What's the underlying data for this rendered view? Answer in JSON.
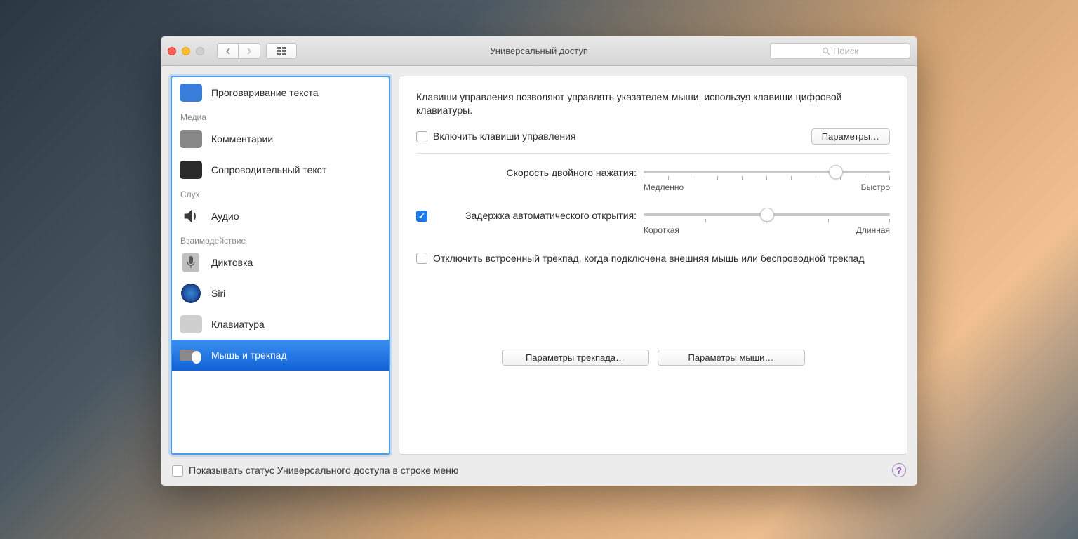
{
  "window": {
    "title": "Универсальный доступ"
  },
  "search": {
    "placeholder": "Поиск"
  },
  "sidebar": {
    "items": [
      {
        "label": "Проговаривание текста"
      },
      {
        "group": "Медиа"
      },
      {
        "label": "Комментарии"
      },
      {
        "label": "Сопроводительный текст"
      },
      {
        "group": "Слух"
      },
      {
        "label": "Аудио"
      },
      {
        "group": "Взаимодействие"
      },
      {
        "label": "Диктовка"
      },
      {
        "label": "Siri"
      },
      {
        "label": "Клавиатура"
      },
      {
        "label": "Мышь и трекпад"
      }
    ]
  },
  "main": {
    "description": "Клавиши управления позволяют управлять указателем мыши, используя клавиши цифровой клавиатуры.",
    "enable_keys": "Включить клавиши управления",
    "options_btn": "Параметры…",
    "double_click_label": "Скорость двойного нажатия:",
    "double_click_min": "Медленно",
    "double_click_max": "Быстро",
    "spring_delay_label": "Задержка автоматического открытия:",
    "spring_delay_min": "Короткая",
    "spring_delay_max": "Длинная",
    "disable_trackpad": "Отключить встроенный трекпад, когда подключена внешняя мышь или беспроводной трекпад",
    "trackpad_options_btn": "Параметры трекпада…",
    "mouse_options_btn": "Параметры мыши…"
  },
  "footer": {
    "show_status": "Показывать статус Универсального доступа в строке меню"
  },
  "sliders": {
    "double_click_pct": 78,
    "spring_delay_pct": 50
  }
}
